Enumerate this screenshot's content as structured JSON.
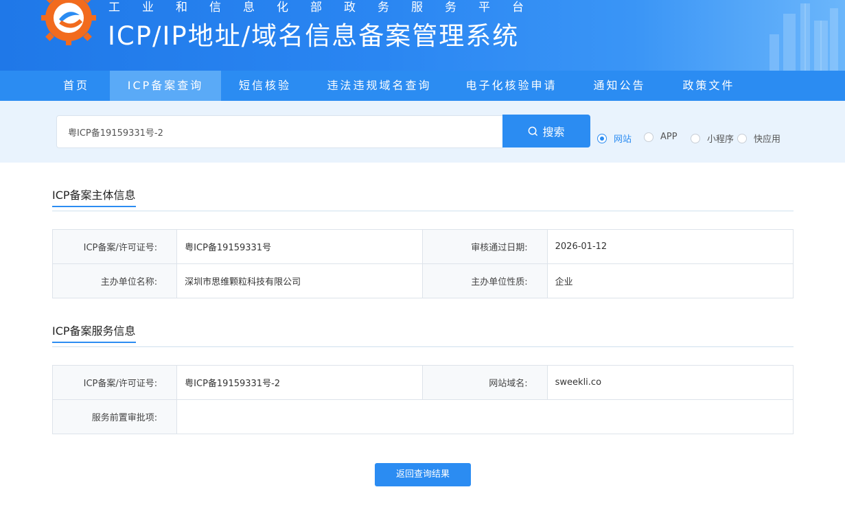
{
  "header": {
    "subtitle": "工业和信息化部政务服务平台",
    "title": "ICP/IP地址/域名信息备案管理系统"
  },
  "nav": {
    "items": [
      {
        "label": "首页"
      },
      {
        "label": "ICP备案查询",
        "active": true
      },
      {
        "label": "短信核验"
      },
      {
        "label": "违法违规域名查询"
      },
      {
        "label": "电子化核验申请"
      },
      {
        "label": "通知公告"
      },
      {
        "label": "政策文件"
      }
    ]
  },
  "search": {
    "value": "粤ICP备19159331号-2",
    "button_label": "搜索",
    "search_icon": "search-icon",
    "options": [
      {
        "label": "网站",
        "checked": true
      },
      {
        "label": "APP",
        "checked": false
      },
      {
        "label": "小程序",
        "checked": false
      },
      {
        "label": "快应用",
        "checked": false
      }
    ]
  },
  "subject_section": {
    "title": "ICP备案主体信息",
    "rows": [
      {
        "label1": "ICP备案/许可证号:",
        "value1": "粤ICP备19159331号",
        "label2": "审核通过日期:",
        "value2": "2026-01-12"
      },
      {
        "label1": "主办单位名称:",
        "value1": "深圳市思维颗粒科技有限公司",
        "label2": "主办单位性质:",
        "value2": "企业"
      }
    ]
  },
  "service_section": {
    "title": "ICP备案服务信息",
    "row1": {
      "label1": "ICP备案/许可证号:",
      "value1": "粤ICP备19159331号-2",
      "label2": "网站域名:",
      "value2": "sweekli.co"
    },
    "row2": {
      "label": "服务前置审批项:",
      "value": ""
    }
  },
  "back_button": {
    "label": "返回查询结果"
  },
  "colors": {
    "primary": "#2b8cf2",
    "nav_active": "#5aaaf7",
    "search_band": "#e9f3fd"
  }
}
